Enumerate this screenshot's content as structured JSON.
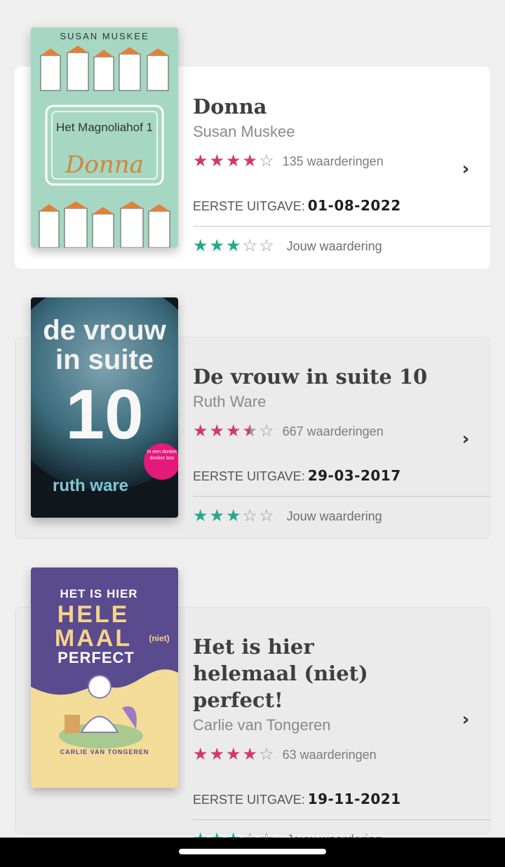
{
  "books": [
    {
      "title": "Donna",
      "author": "Susan Muskee",
      "community_rating": 4,
      "ratings_count": "135 waarderingen",
      "first_edition_label": "EERSTE UITGAVE:",
      "first_edition_date": "01-08-2022",
      "user_rating": 3,
      "user_rating_label": "Jouw waardering",
      "cover": {
        "author": "SUSAN MUSKEE",
        "series": "Het Magnoliahof 1",
        "title": "Donna",
        "bg": "#a6d7c2"
      }
    },
    {
      "title": "De vrouw in suite 10",
      "author": "Ruth Ware",
      "community_rating": 3.5,
      "ratings_count": "667 waarderingen",
      "first_edition_label": "EERSTE UITGAVE:",
      "first_edition_date": "29-03-2017",
      "user_rating": 3,
      "user_rating_label": "Jouw waardering",
      "cover": {
        "title": "de vrouw in suite",
        "number": "10",
        "author": "ruth ware",
        "badge": "In een donker donker bos",
        "bg": "#1e3b48"
      }
    },
    {
      "title": "Het is hier helemaal (niet) perfect!",
      "author": "Carlie van Tongeren",
      "community_rating": 4,
      "ratings_count": "63 waarderingen",
      "first_edition_label": "EERSTE UITGAVE:",
      "first_edition_date": "19-11-2021",
      "user_rating": 3,
      "user_rating_label": "Jouw waardering",
      "cover": {
        "line1": "HET IS HIER",
        "line2": "HELE",
        "line3": "MAAL",
        "line4": "PERFECT",
        "niet": "(niet)",
        "author": "CARLIE VAN TONGEREN",
        "bg": "#f3dc97",
        "top_bg": "#5a4a8e"
      }
    }
  ],
  "colors": {
    "community_star": "#d23a62",
    "user_star": "#24a98f",
    "empty_star": "#999999"
  },
  "icons": [
    "chevron-right-icon",
    "star-icon"
  ]
}
